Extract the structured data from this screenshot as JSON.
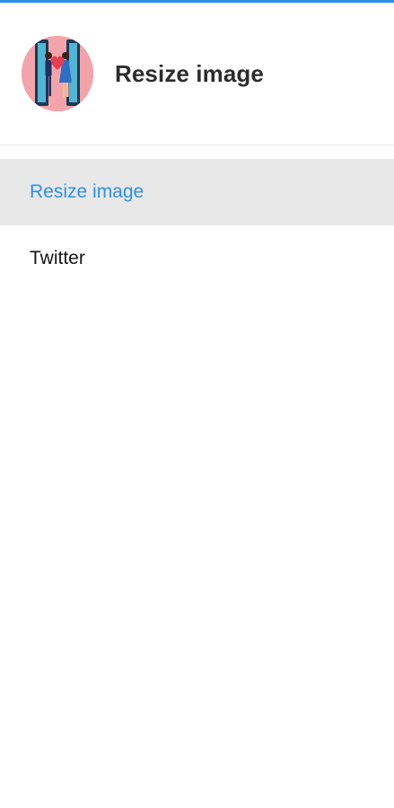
{
  "header": {
    "title": "Resize image",
    "avatar_icon": "couple-phones-heart-icon"
  },
  "menu": {
    "items": [
      {
        "label": "Resize image",
        "active": true
      },
      {
        "label": "Twitter",
        "active": false
      }
    ]
  },
  "colors": {
    "accent": "#2f8fe9",
    "active_background": "#e8e8e8",
    "divider": "#e6e6e6",
    "avatar_background": "#f3a3aa"
  }
}
